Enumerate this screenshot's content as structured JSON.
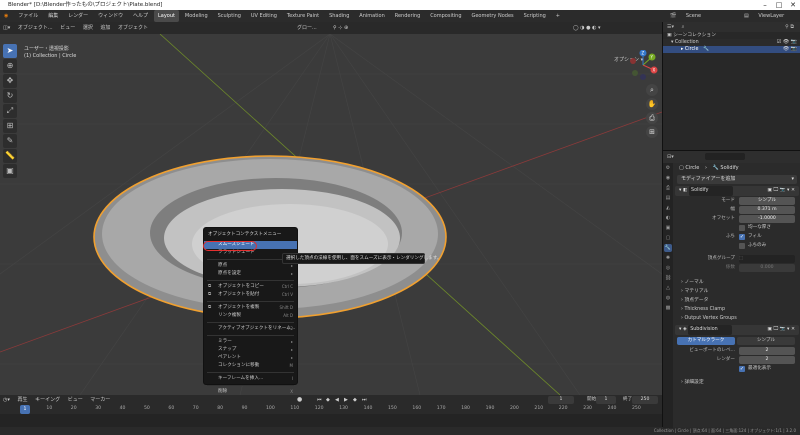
{
  "window": {
    "title": "Blender* [D:\\Blender作ったもの\\プロジェクト\\Plate.blend]"
  },
  "menu": [
    "ファイル",
    "編集",
    "レンダー",
    "ウィンドウ",
    "ヘルプ"
  ],
  "workspace_tabs": [
    "Layout",
    "Modeling",
    "Sculpting",
    "UV Editing",
    "Texture Paint",
    "Shading",
    "Animation",
    "Rendering",
    "Compositing",
    "Geometry Nodes",
    "Scripting",
    "+"
  ],
  "scene": "Scene",
  "view_layer": "ViewLayer",
  "viewport": {
    "header": {
      "mode": "オブジェクト...",
      "view": "ビュー",
      "select": "選択",
      "add": "追加",
      "object": "オブジェクト",
      "transform": "グロー..."
    },
    "info_line1": "ユーザー・透視投影",
    "info_line2": "(1) Collection | Circle",
    "options": "オプション ▾",
    "gizmo": {
      "x": "X",
      "y": "Y",
      "z": "Z"
    }
  },
  "context_menu": {
    "title": "オブジェクトコンテクストメニュー",
    "items": [
      {
        "label": "スムーズシェード",
        "shortcut": "",
        "sel": true
      },
      {
        "label": "フラットシェード",
        "shortcut": ""
      },
      {
        "sep": true
      },
      {
        "label": "原点",
        "shortcut": "▸"
      },
      {
        "label": "原点を設定",
        "shortcut": "▸"
      },
      {
        "sep": true
      },
      {
        "label": "オブジェクトをコピー",
        "shortcut": "Ctrl C",
        "icon": "⧉"
      },
      {
        "label": "オブジェクトを貼付",
        "shortcut": "Ctrl V",
        "icon": "⧉"
      },
      {
        "sep": true
      },
      {
        "label": "オブジェクトを複製",
        "shortcut": "Shift D",
        "icon": "⧉"
      },
      {
        "label": "リンク複製",
        "shortcut": "Alt D"
      },
      {
        "sep": true
      },
      {
        "label": "アクティブオブジェクトをリネーム...",
        "shortcut": "F2"
      },
      {
        "sep": true
      },
      {
        "label": "ミラー",
        "shortcut": "▸"
      },
      {
        "label": "スナップ",
        "shortcut": "▸"
      },
      {
        "label": "ペアレント",
        "shortcut": "▸"
      },
      {
        "label": "コレクションに移動",
        "shortcut": "M"
      },
      {
        "sep": true
      },
      {
        "label": "キーフレームを挿入...",
        "shortcut": "I"
      },
      {
        "sep": true
      },
      {
        "label": "削除",
        "shortcut": "X"
      }
    ]
  },
  "tooltip": "選択した頂点の法線を使用し、面をスムーズに表示・レンダリングします。",
  "timeline": {
    "menu": [
      "再生",
      "キーイング",
      "ビュー",
      "マーカー"
    ],
    "current_frame": "1",
    "start_label": "開始",
    "start": "1",
    "end_label": "終了",
    "end": "250",
    "ticks": [
      "0",
      "10",
      "20",
      "30",
      "40",
      "50",
      "60",
      "70",
      "80",
      "90",
      "100",
      "110",
      "120",
      "130",
      "140",
      "150",
      "160",
      "170",
      "180",
      "190",
      "200",
      "210",
      "220",
      "230",
      "240",
      "250"
    ]
  },
  "status": "Collection | Circle | 頂点:64 | 面:64 | 三角面:124 | オブジェクト:1/1 | 3.2.0",
  "outliner": {
    "rows": [
      {
        "label": "シーンコレクション",
        "indent": 4
      },
      {
        "label": "▾ Collection",
        "indent": 8
      },
      {
        "label": "▸ Circle",
        "indent": 18,
        "sel": true
      }
    ]
  },
  "properties": {
    "breadcrumb_object": "Circle",
    "breadcrumb_modifier": "Solidify",
    "add_modifier": "モディファイアーを追加",
    "solidify": {
      "name": "Solidify",
      "mode_label": "モード",
      "mode": "シンプル",
      "thickness_label": "幅",
      "thickness": "0.371 m",
      "offset_label": "オフセット",
      "offset": "-1.0000",
      "even_label": "均一な厚さ",
      "rim_label": "ふち",
      "fill_label": "フィル",
      "only_rim_label": "ふちのみ",
      "vgroup_label": "頂点グループ",
      "factor_label": "係数",
      "factor": "0.000"
    },
    "solidify_subpanels": [
      "ノーマル",
      "マテリアル",
      "頂点データ",
      "Thickness Clamp",
      "Output Vertex Groups"
    ],
    "subsurf": {
      "name": "Subdivision",
      "tab_catmull": "カトマルクラーク",
      "tab_simple": "シンプル",
      "viewport_label": "ビューポートのレベ...",
      "viewport": "2",
      "render_label": "レンダー",
      "render": "2",
      "optimal_label": "最適化表示",
      "advanced": "詳細設定"
    }
  },
  "colors": {
    "accent": "#4772b3",
    "selection_outline": "#f0a030",
    "highlight_ring": "#e53030"
  }
}
